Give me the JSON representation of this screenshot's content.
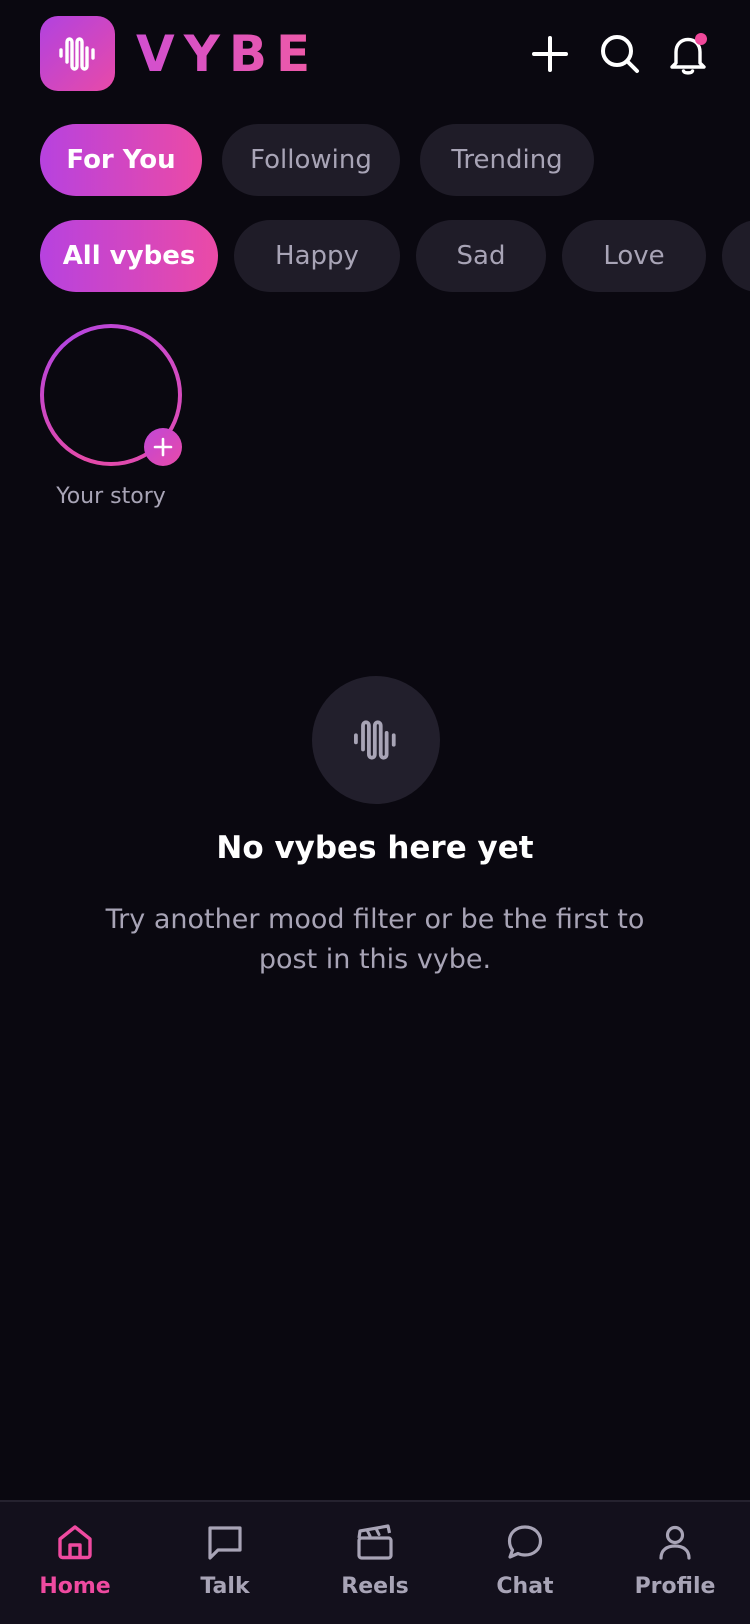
{
  "app": {
    "name": "VYBE"
  },
  "colors": {
    "accent_start": "#b742df",
    "accent_end": "#eb4aa6",
    "background": "#0a0810",
    "chip_bg": "#1f1c28",
    "muted_text": "#a8a4b6",
    "notification_dot": "#f0489a"
  },
  "header": {
    "logo_icon": "waveform-icon",
    "actions": [
      {
        "icon": "plus-icon"
      },
      {
        "icon": "search-icon"
      },
      {
        "icon": "bell-icon",
        "has_notification": true
      }
    ]
  },
  "feed_tabs": [
    {
      "label": "For You",
      "active": true
    },
    {
      "label": "Following",
      "active": false
    },
    {
      "label": "Trending",
      "active": false
    }
  ],
  "mood_filters": [
    {
      "label": "All vybes",
      "active": true
    },
    {
      "label": "Happy",
      "active": false
    },
    {
      "label": "Sad",
      "active": false
    },
    {
      "label": "Love",
      "active": false
    },
    {
      "label": "",
      "active": false
    }
  ],
  "story": {
    "label": "Your story",
    "add_icon": "plus-icon"
  },
  "empty_state": {
    "icon": "waveform-icon",
    "title": "No vybes here yet",
    "subtitle": "Try another mood filter or be the first to post in this vybe."
  },
  "bottom_nav": [
    {
      "label": "Home",
      "icon": "home-icon",
      "active": true
    },
    {
      "label": "Talk",
      "icon": "message-square-icon",
      "active": false
    },
    {
      "label": "Reels",
      "icon": "clapperboard-icon",
      "active": false
    },
    {
      "label": "Chat",
      "icon": "chat-bubble-icon",
      "active": false
    },
    {
      "label": "Profile",
      "icon": "user-icon",
      "active": false
    }
  ]
}
